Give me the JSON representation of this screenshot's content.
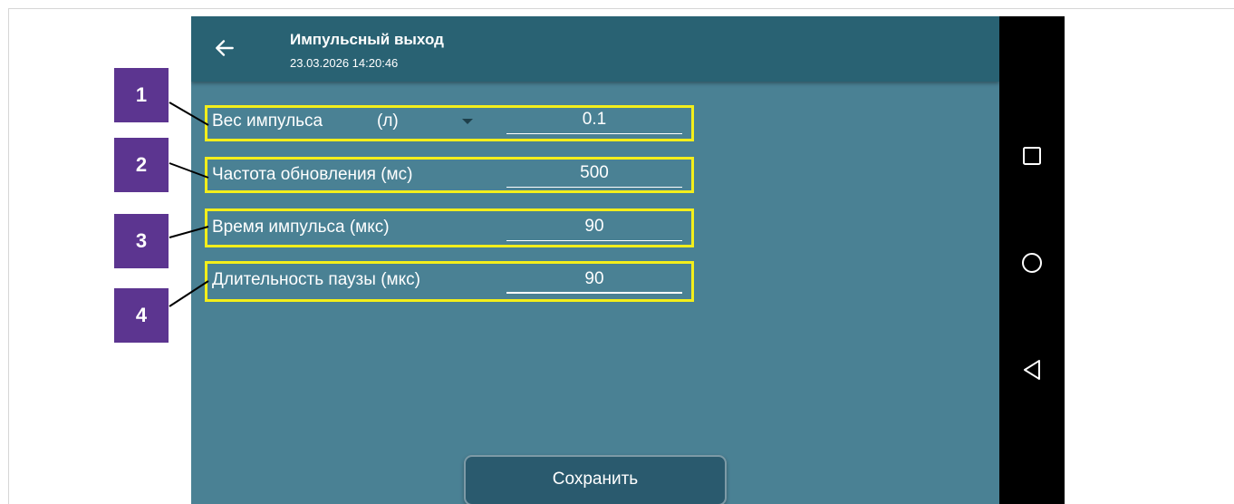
{
  "header": {
    "title": "Импульсный выход",
    "timestamp": "23.03.2026 14:20:46",
    "back_icon": "arrow-left-icon"
  },
  "settings": [
    {
      "label": "Вес импульса",
      "unit": "(л)",
      "value": "0.1",
      "has_dropdown": true
    },
    {
      "label": "Частота обновления (мс)",
      "value": "500"
    },
    {
      "label": "Время импульса (мкс)",
      "value": "90"
    },
    {
      "label": "Длительность паузы (мкс)",
      "value": "90"
    }
  ],
  "save_button": {
    "label": "Сохранить"
  },
  "callouts": [
    "1",
    "2",
    "3",
    "4"
  ],
  "nav_bar": {
    "icons": [
      "recents-square-icon",
      "home-circle-icon",
      "back-triangle-icon"
    ]
  },
  "colors": {
    "header": "#296273",
    "screen": "#4a8194",
    "highlight": "#f3ee1b",
    "badge": "#5c3590"
  }
}
